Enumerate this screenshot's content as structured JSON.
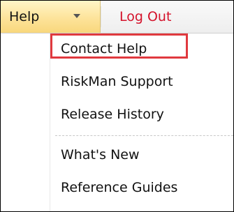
{
  "menubar": {
    "help_label": "Help",
    "logout_label": "Log Out"
  },
  "dropdown": {
    "items": [
      {
        "label": "Contact Help"
      },
      {
        "label": "RiskMan Support"
      },
      {
        "label": "Release History"
      },
      {
        "label": "What's New"
      },
      {
        "label": "Reference Guides"
      }
    ]
  },
  "colors": {
    "help_bg": "#fde39a",
    "logout_text": "#d4122b",
    "highlight_border": "#e0393e"
  },
  "icons": {
    "help_dropdown": "chevron-down-icon"
  }
}
